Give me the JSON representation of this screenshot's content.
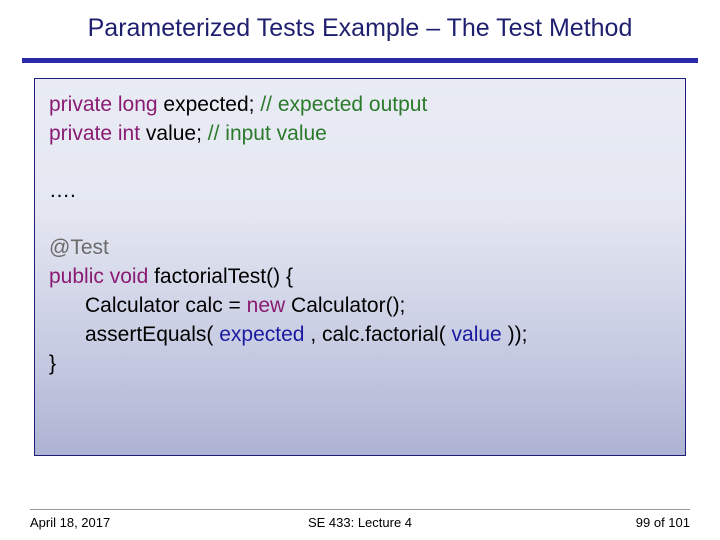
{
  "title": "Parameterized Tests Example – The Test Method",
  "code": {
    "kw_private1": "private",
    "kw_long": "long",
    "fld_expected_decl": " expected; ",
    "cmt_expected": "// expected output",
    "kw_private2": "private",
    "kw_int": "int",
    "fld_value_decl": " value;          ",
    "cmt_value": "// input value",
    "dots": "….",
    "annotation": "@Test",
    "kw_public": "public",
    "kw_void": "void",
    "method_sig": " factorialTest() {",
    "line_calc_a": "Calculator calc = ",
    "kw_new": "new",
    "line_calc_b": " Calculator();",
    "assert_a": "assertEquals(",
    "assert_expected": "expected",
    "assert_mid": ", calc.factorial(",
    "assert_value": "value",
    "assert_end": "));",
    "brace_close": "}"
  },
  "footer": {
    "date": "April 18, 2017",
    "center": "SE 433: Lecture 4",
    "page": "99 of 101"
  }
}
